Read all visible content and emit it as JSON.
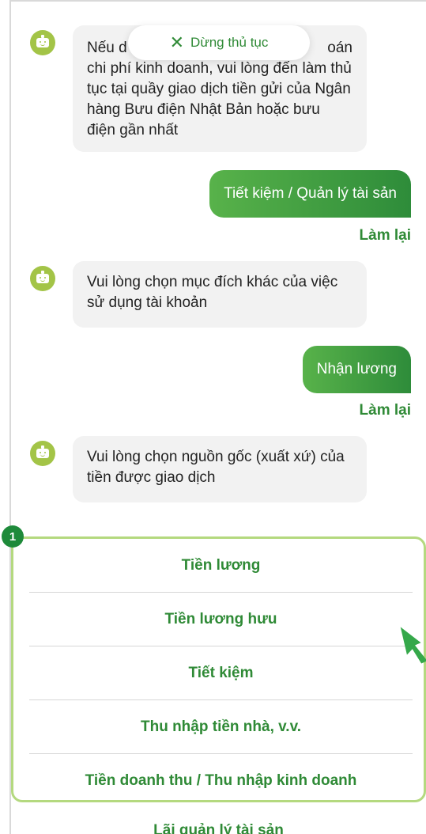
{
  "chat": {
    "messages": [
      {
        "role": "bot",
        "text_part1": "Nếu d",
        "text_part2": "oán",
        "text_rest": "chi phí kinh doanh, vui lòng đến làm thủ tục tại quầy giao dịch tiền gửi của Ngân hàng Bưu điện Nhật Bản hoặc bưu điện gần nhất"
      },
      {
        "role": "user",
        "text": "Tiết kiệm / Quản lý tài sản",
        "redo": "Làm lại"
      },
      {
        "role": "bot",
        "text": "Vui lòng chọn mục đích khác của việc sử dụng tài khoản"
      },
      {
        "role": "user",
        "text": "Nhận lương",
        "redo": "Làm lại"
      },
      {
        "role": "bot",
        "text": "Vui lòng chọn nguồn gốc (xuất xứ) của tiền được giao dịch"
      }
    ]
  },
  "stop_button": {
    "icon": "close-icon",
    "label": "Dừng thủ tục"
  },
  "step_badge": "1",
  "options": [
    "Tiền lương",
    "Tiền lương hưu",
    "Tiết kiệm",
    "Thu nhập tiền nhà, v.v.",
    "Tiền doanh thu / Thu nhập kinh doanh",
    "Lãi quản lý tài sản"
  ],
  "colors": {
    "accent": "#2f8a36",
    "bot_avatar": "#a3c447",
    "highlight_border": "#b4d97f",
    "badge": "#1e8a3a"
  }
}
